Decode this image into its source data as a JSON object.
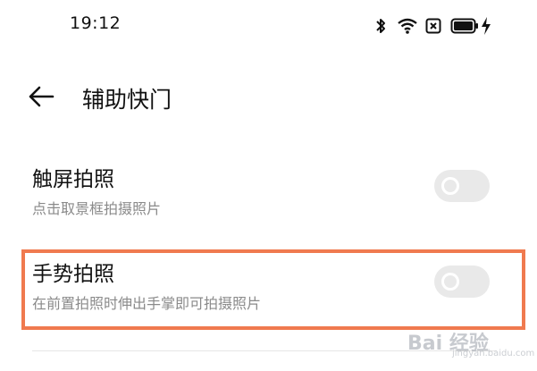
{
  "status_bar": {
    "time": "19:12",
    "icons": [
      "bluetooth-icon",
      "wifi-icon",
      "sim-icon",
      "battery-icon",
      "charging-icon"
    ]
  },
  "header": {
    "back_icon": "arrow-left-icon",
    "title": "辅助快门"
  },
  "settings": [
    {
      "title": "触屏拍照",
      "description": "点击取景框拍摄照片",
      "enabled": false
    },
    {
      "title": "手势拍照",
      "description": "在前置拍照时伸出手掌即可拍摄照片",
      "enabled": false,
      "highlighted": true
    }
  ],
  "colors": {
    "highlight": "#f07a4f",
    "toggle_off": "#e9e9e9",
    "description_text": "#8a8a8a"
  },
  "watermark": {
    "text": "Bai 经验",
    "sub": "jingyan.baidu.com"
  }
}
